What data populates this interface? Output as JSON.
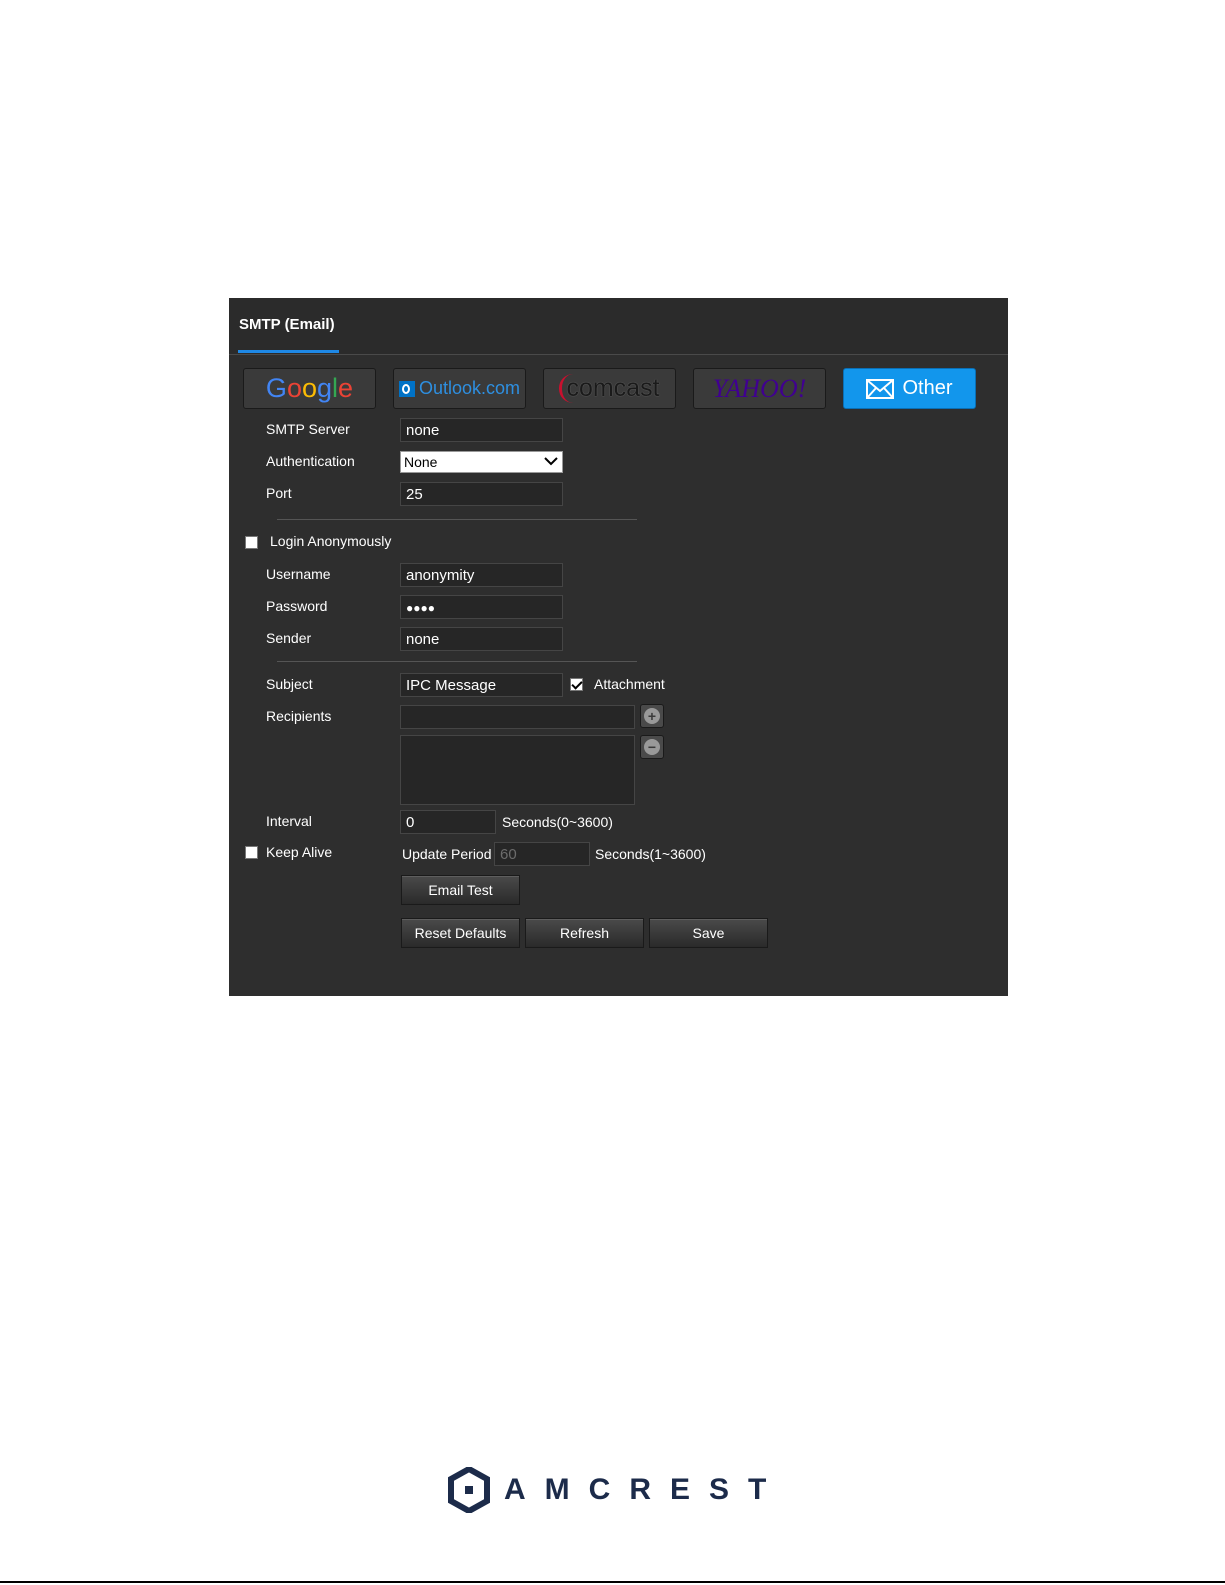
{
  "tab": {
    "label": "SMTP (Email)"
  },
  "providers": {
    "google": "Google",
    "outlook": "Outlook.com",
    "comcast": "comcast",
    "yahoo": "YAHOO!",
    "other": "Other"
  },
  "form": {
    "smtp_server": {
      "label": "SMTP Server",
      "value": "none"
    },
    "authentication": {
      "label": "Authentication",
      "value": "None"
    },
    "port": {
      "label": "Port",
      "value": "25"
    },
    "login_anonymously": {
      "label": "Login Anonymously",
      "checked": false
    },
    "username": {
      "label": "Username",
      "value": "anonymity"
    },
    "password": {
      "label": "Password",
      "value": "●●●●"
    },
    "sender": {
      "label": "Sender",
      "value": "none"
    },
    "subject": {
      "label": "Subject",
      "value": "IPC Message"
    },
    "attachment": {
      "label": "Attachment",
      "checked": true
    },
    "recipients": {
      "label": "Recipients",
      "value": ""
    },
    "interval": {
      "label": "Interval",
      "value": "0",
      "unit": "Seconds(0~3600)"
    },
    "keep_alive": {
      "label": "Keep Alive",
      "checked": false
    },
    "update_period": {
      "label": "Update Period",
      "value": "60",
      "unit": "Seconds(1~3600)"
    }
  },
  "buttons": {
    "email_test": "Email Test",
    "reset_defaults": "Reset Defaults",
    "refresh": "Refresh",
    "save": "Save"
  },
  "footer": {
    "brand": "AMCREST"
  },
  "colors": {
    "panel": "#2e2e2e",
    "accent": "#1296ec",
    "brand": "#1c2b4a"
  }
}
